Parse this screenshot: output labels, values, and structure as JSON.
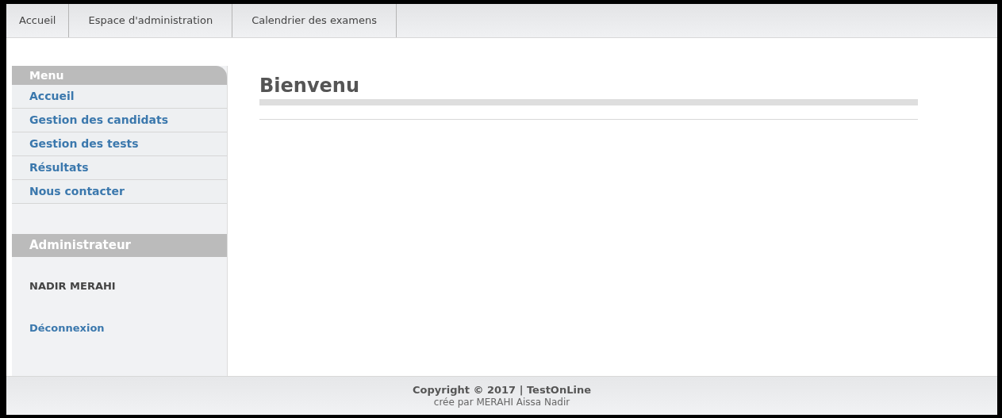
{
  "nav_tabs": [
    {
      "label": "Accueil"
    },
    {
      "label": "Espace d'administration"
    },
    {
      "label": "Calendrier des examens"
    }
  ],
  "sidebar": {
    "menu_title": "Menu",
    "items": [
      {
        "label": "Accueil"
      },
      {
        "label": "Gestion des candidats"
      },
      {
        "label": "Gestion des tests"
      },
      {
        "label": "Résultats"
      },
      {
        "label": "Nous contacter"
      }
    ],
    "admin_title": "Administrateur",
    "user_name": "NADIR MERAHI",
    "logout": "Déconnexion"
  },
  "content": {
    "heading": "Bienvenu"
  },
  "footer": {
    "copyright": "Copyright © 2017 | TestOnLine",
    "credit": "crée par MERAHI Aissa Nadir"
  }
}
